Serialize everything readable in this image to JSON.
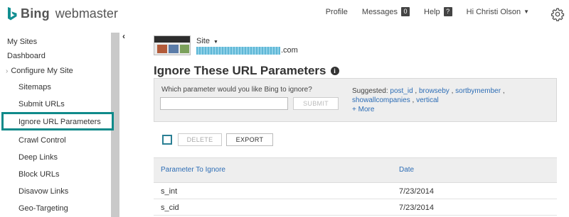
{
  "header": {
    "brand": "Bing",
    "product": "webmaster",
    "nav": {
      "profile": "Profile",
      "messages": "Messages",
      "messages_count": "0",
      "help": "Help",
      "help_icon": "?",
      "user": "Hi Christi Olson"
    },
    "icons": {
      "logo": "bing-b-logo",
      "settings": "gear-icon",
      "user_menu": "caret-down-icon"
    }
  },
  "sidebar": {
    "my_sites": "My Sites",
    "dashboard": "Dashboard",
    "configure": "Configure My Site",
    "items": [
      {
        "label": "Sitemaps"
      },
      {
        "label": "Submit URLs"
      },
      {
        "label": "Ignore URL Parameters",
        "active": true
      },
      {
        "label": "Crawl Control"
      },
      {
        "label": "Deep Links"
      },
      {
        "label": "Block URLs"
      },
      {
        "label": "Disavow Links"
      },
      {
        "label": "Geo-Targeting"
      }
    ],
    "collapse_glyph": "‹"
  },
  "site": {
    "label": "Site",
    "url_suffix": ".com"
  },
  "page": {
    "title": "Ignore These URL Parameters",
    "info_glyph": "i"
  },
  "ignore_form": {
    "question": "Which parameter would you like Bing to ignore?",
    "input_value": "",
    "submit": "SUBMIT",
    "suggested_label": "Suggested:",
    "suggestions": [
      "post_id",
      "browseby",
      "sortbymember",
      "showallcompanies",
      "vertical"
    ],
    "more": "+ More"
  },
  "toolbar": {
    "delete": "DELETE",
    "export": "EXPORT"
  },
  "table": {
    "columns": [
      "Parameter To Ignore",
      "Date"
    ],
    "rows": [
      [
        "s_int",
        "7/23/2014"
      ],
      [
        "s_cid",
        "7/23/2014"
      ]
    ]
  },
  "colors": {
    "accent_teal": "#0f8a8a",
    "link_blue": "#2d6db5",
    "panel_gray": "#eeeeee"
  }
}
